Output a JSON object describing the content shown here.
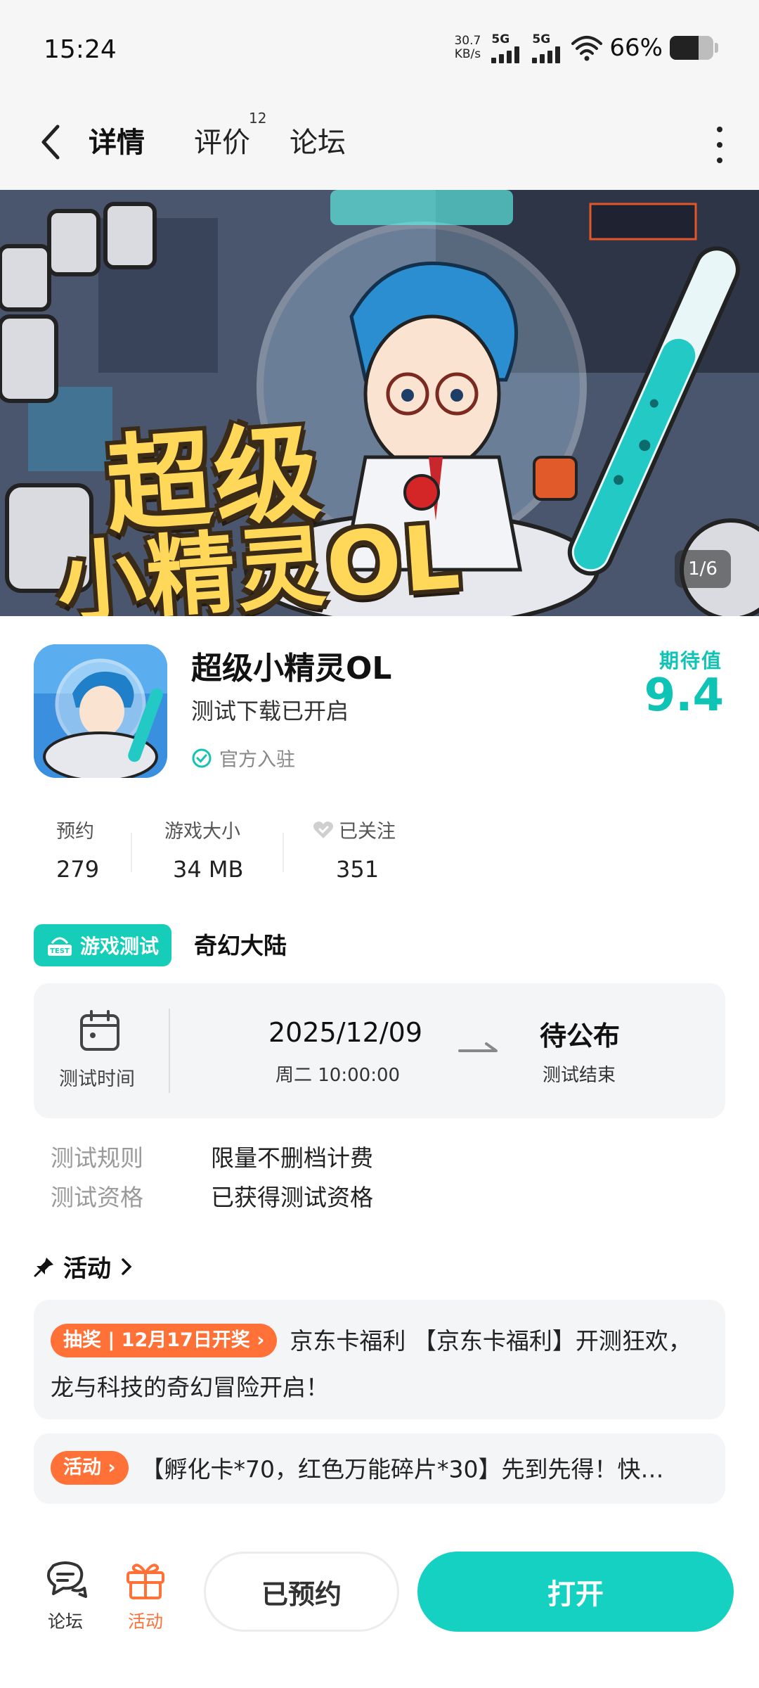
{
  "status_bar": {
    "time": "15:24",
    "net_speed_value": "30.7",
    "net_speed_unit": "KB/s",
    "signal_1_label": "5G",
    "signal_2_label": "5G",
    "battery_percent": "66%",
    "battery_level": 0.66
  },
  "nav": {
    "tab_details": "详情",
    "tab_reviews": "评价",
    "reviews_count": "12",
    "tab_forum": "论坛"
  },
  "banner": {
    "title_line1": "超级",
    "title_line2": "小精灵OL",
    "counter": "1/6"
  },
  "app": {
    "name": "超级小精灵OL",
    "subtitle": "测试下载已开启",
    "official": "官方入驻",
    "expect_label": "期待值",
    "expect_score": "9.4"
  },
  "stats": {
    "reserve_label": "预约",
    "reserve_value": "279",
    "size_label": "游戏大小",
    "size_value": "34 MB",
    "follow_label": "已关注",
    "follow_value": "351"
  },
  "test": {
    "tag": "游戏测试",
    "tag_icon_text": "TEST",
    "name": "奇幻大陆",
    "time_label": "测试时间",
    "date": "2025/12/09",
    "weekday_time": "周二  10:00:00",
    "end_value": "待公布",
    "end_label": "测试结束",
    "rule_label": "测试规则",
    "rule_value": "限量不删档计费",
    "qual_label": "测试资格",
    "qual_value": "已获得测试资格"
  },
  "activity": {
    "header": "活动",
    "item1_badge": "抽奖 | 12月17日开奖",
    "item1_text": "京东卡福利 【京东卡福利】开测狂欢，龙与科技的奇幻冒险开启！",
    "item2_badge": "活动",
    "item2_text": "【孵化卡*70，红色万能碎片*30】先到先得！快…"
  },
  "bottom": {
    "forum_label": "论坛",
    "activity_label": "活动",
    "reserved_label": "已预约",
    "open_label": "打开"
  },
  "colors": {
    "accent": "#15d1c2",
    "orange": "#ff7136",
    "card_bg": "#f4f5f7"
  }
}
